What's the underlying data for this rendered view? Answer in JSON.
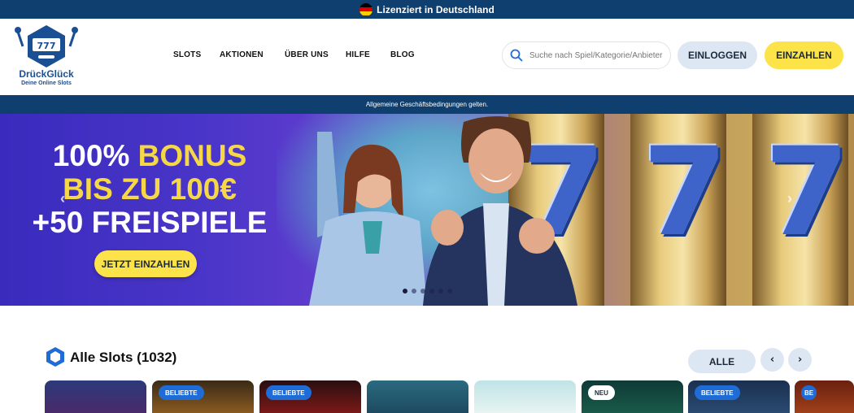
{
  "license_bar": {
    "text": "Lizenziert in Deutschland",
    "flag_icon": "germany-flag-icon"
  },
  "header": {
    "logo_title": "DrückGlück",
    "logo_subtitle": "Deine Online Slots",
    "nav": [
      {
        "label": "SLOTS"
      },
      {
        "label": "AKTIONEN"
      },
      {
        "label": "ÜBER UNS"
      },
      {
        "label": "HILFE"
      },
      {
        "label": "BLOG"
      }
    ],
    "search": {
      "placeholder": "Suche nach Spiel/Kategorie/Anbieter",
      "icon": "search-icon"
    },
    "login_label": "EINLOGGEN",
    "deposit_label": "EINZAHLEN"
  },
  "terms_bar": {
    "text": "Allgemeine Geschäftsbedingungen gelten."
  },
  "hero": {
    "line1_a": "100%",
    "line1_b": "BONUS",
    "line2": "BIS ZU 100€",
    "line3": "+50 FREISPIELE",
    "cta_label": "JETZT EINZAHLEN",
    "slide_count": 6,
    "active_slide": 1,
    "reel_symbol": "7"
  },
  "slots_section": {
    "title": "Alle Slots (1032)",
    "all_label": "ALLE",
    "prev_icon": "chevron-left-icon",
    "next_icon": "chevron-right-icon",
    "tiles": [
      {
        "badge": ""
      },
      {
        "badge": "BELIEBTE"
      },
      {
        "badge": "BELIEBTE"
      },
      {
        "badge": ""
      },
      {
        "badge": ""
      },
      {
        "badge": "NEU"
      },
      {
        "badge": "BELIEBTE"
      },
      {
        "badge": "BE"
      }
    ]
  },
  "colors": {
    "navy": "#0f3f6e",
    "yellow": "#fde34a",
    "light_blue": "#dde7f4",
    "brand_blue": "#1a4f93",
    "badge_blue": "#1f6cd6"
  }
}
